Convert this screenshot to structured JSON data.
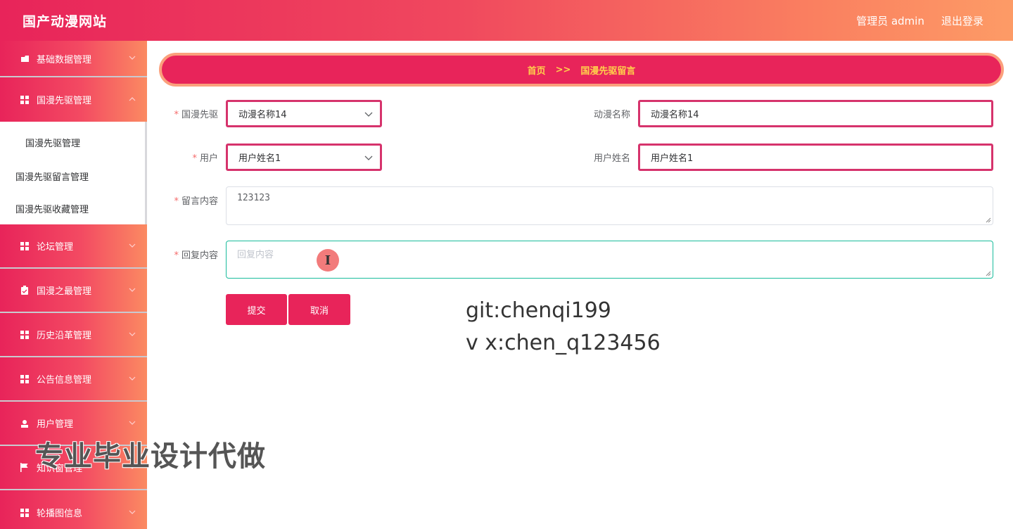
{
  "header": {
    "app_title": "国产动漫网站",
    "user_label": "管理员 admin",
    "logout_label": "退出登录"
  },
  "sidebar": {
    "items": [
      {
        "label": "基础数据管理",
        "icon": "folder-icon"
      },
      {
        "label": "国漫先驱管理",
        "icon": "grid-icon"
      },
      {
        "label": "论坛管理",
        "icon": "grid-icon"
      },
      {
        "label": "国漫之最管理",
        "icon": "clipboard-icon"
      },
      {
        "label": "历史沿革管理",
        "icon": "grid-icon"
      },
      {
        "label": "公告信息管理",
        "icon": "grid-icon"
      },
      {
        "label": "用户管理",
        "icon": "user-icon"
      },
      {
        "label": "知识窗管理",
        "icon": "flag-icon"
      },
      {
        "label": "轮播图信息",
        "icon": "grid-icon"
      }
    ],
    "submenu": [
      {
        "label": "国漫先驱管理"
      },
      {
        "label": "国漫先驱留言管理"
      },
      {
        "label": "国漫先驱收藏管理"
      }
    ]
  },
  "breadcrumb": {
    "home": "首页",
    "separator": ">>",
    "current": "国漫先驱留言"
  },
  "form": {
    "pioneer_label": "国漫先驱",
    "pioneer_value": "动漫名称14",
    "anime_name_label": "动漫名称",
    "anime_name_value": "动漫名称14",
    "user_label": "用户",
    "user_value": "用户姓名1",
    "user_name_label": "用户姓名",
    "user_name_value": "用户姓名1",
    "message_label": "留言内容",
    "message_value": "123123",
    "reply_label": "回复内容",
    "reply_placeholder": "回复内容",
    "required_mark": "*",
    "submit_label": "提交",
    "cancel_label": "取消"
  },
  "overlay": {
    "line1": "git:chenqi199",
    "line2": "v x:chen_q123456",
    "watermark": "专业毕业设计代做",
    "cursor_glyph": "I"
  },
  "colors": {
    "primary": "#e8245a",
    "header_gradient_end": "#fd9b66",
    "breadcrumb_text": "#ffd04b",
    "required": "#f56c6c",
    "focus_border": "#1abc9c"
  }
}
